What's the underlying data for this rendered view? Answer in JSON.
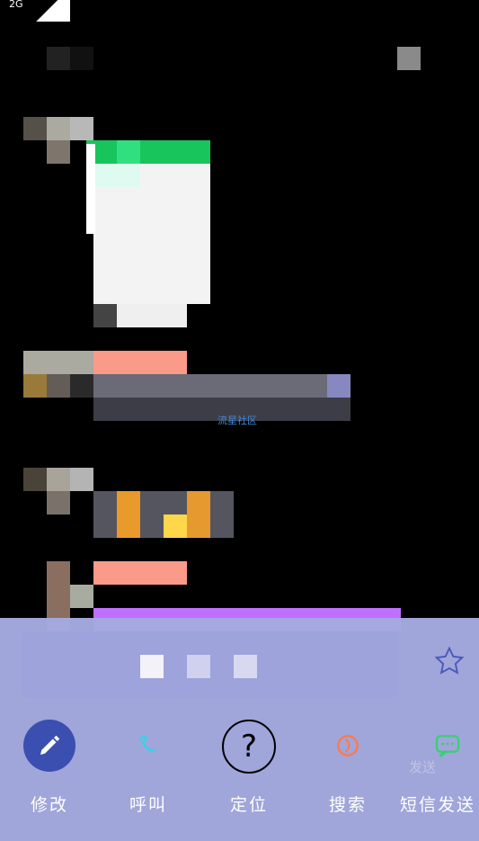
{
  "status_bar": {
    "network": "2G"
  },
  "feed": {
    "link_label": "流星社区"
  },
  "share_sheet": {
    "actions": [
      {
        "label": "修改",
        "icon": "pencil-icon",
        "color": "#3b4fb0"
      },
      {
        "label": "呼叫",
        "icon": "call-icon",
        "color": "#30d6e8"
      },
      {
        "label": "定位",
        "icon": "question-icon",
        "color": "#000000"
      },
      {
        "label": "搜索",
        "icon": "search-icon",
        "color": "#ff7a4a"
      },
      {
        "label": "短信发送",
        "icon": "sms-icon",
        "color": "#2fd56a"
      }
    ],
    "send_hint": "发送"
  }
}
